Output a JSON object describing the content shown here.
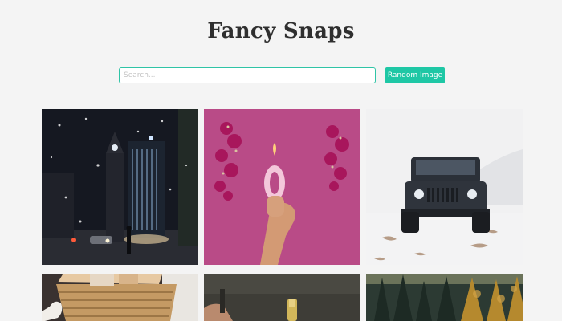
{
  "header": {
    "title": "Fancy Snaps"
  },
  "search": {
    "placeholder": "Search...",
    "value": ""
  },
  "toolbar": {
    "random_label": "Random Image"
  },
  "colors": {
    "accent": "#1ec7a5",
    "background": "#f4f4f4",
    "title": "#2f2f2f"
  },
  "gallery": {
    "images": [
      {
        "subject": "night city street in snow"
      },
      {
        "subject": "hand holding number zero birthday candle"
      },
      {
        "subject": "black jeep in snow"
      },
      {
        "subject": "woven basket"
      },
      {
        "subject": "bottle on dark background"
      },
      {
        "subject": "autumn forest"
      }
    ]
  }
}
